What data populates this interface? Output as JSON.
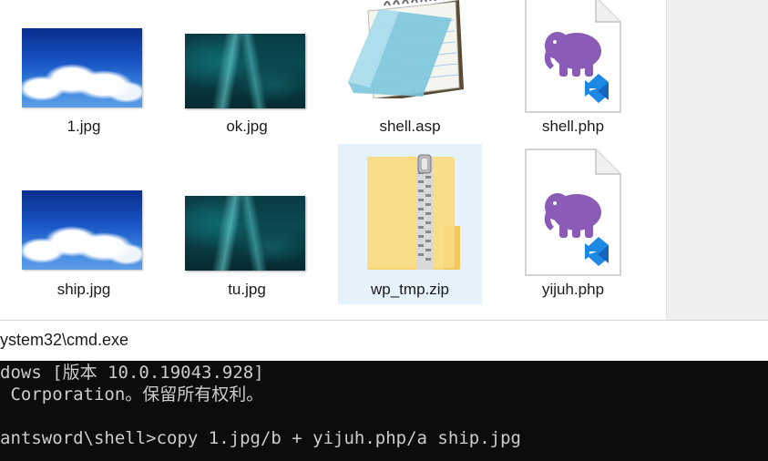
{
  "explorer": {
    "files": [
      {
        "name": "1.jpg",
        "icon": "sky-photo-thumbnail"
      },
      {
        "name": "ok.jpg",
        "icon": "cave-photo-thumbnail"
      },
      {
        "name": "shell.asp",
        "icon": "notepad-icon"
      },
      {
        "name": "shell.php",
        "icon": "php-vscode-file-icon"
      },
      {
        "name": "ship.jpg",
        "icon": "sky-photo-thumbnail"
      },
      {
        "name": "tu.jpg",
        "icon": "cave-photo-thumbnail"
      },
      {
        "name": "wp_tmp.zip",
        "icon": "zip-folder-icon",
        "selected": true
      },
      {
        "name": "yijuh.php",
        "icon": "php-vscode-file-icon"
      }
    ]
  },
  "console": {
    "title": "ystem32\\cmd.exe",
    "lines": [
      "dows [版本 10.0.19043.928]",
      " Corporation。保留所有权利。",
      "",
      "antsword\\shell>copy 1.jpg/b + yijuh.php/a ship.jpg"
    ]
  },
  "colors": {
    "selection": "#e5f1fb",
    "console_bg": "#0c0c0c",
    "console_text": "#cccccc",
    "php_elephant": "#8a5cb7",
    "vscode_blue": "#1e88e5"
  }
}
